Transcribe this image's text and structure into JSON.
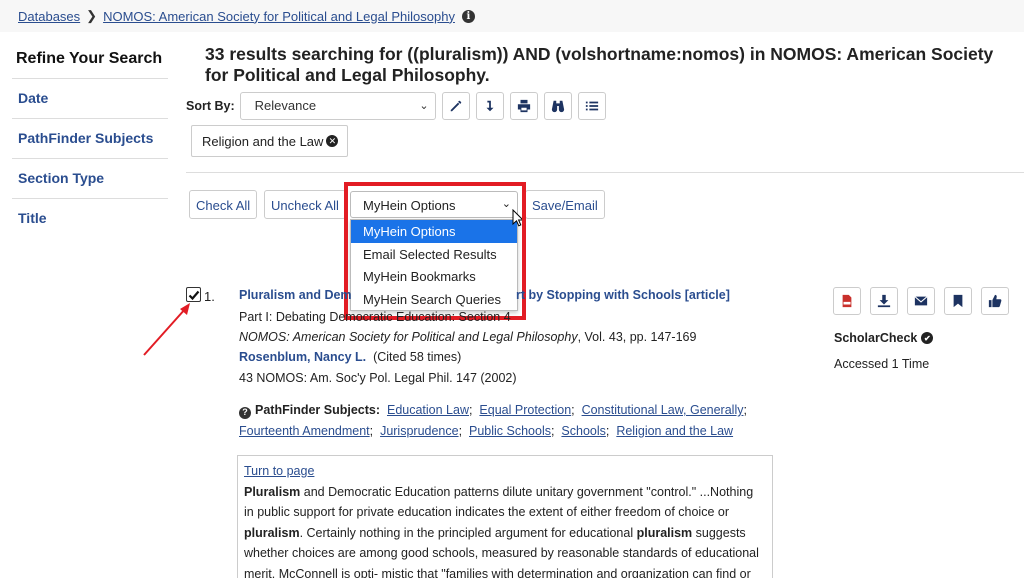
{
  "breadcrumb": {
    "root": "Databases",
    "current": "NOMOS: American Society for Political and Legal Philosophy"
  },
  "sidebar": {
    "title": "Refine Your Search",
    "items": [
      {
        "label": "Date"
      },
      {
        "label": "PathFinder Subjects"
      },
      {
        "label": "Section Type"
      },
      {
        "label": "Title"
      }
    ]
  },
  "results_heading": "33 results searching for ((pluralism)) AND (volshortname:nomos) in NOMOS: American Society for Political and Legal Philosophy.",
  "sort": {
    "label": "Sort By:",
    "value": "Relevance"
  },
  "facet_chip": "Religion and the Law",
  "bulk": {
    "check_all": "Check All",
    "uncheck_all": "Uncheck All",
    "myhein_value": "MyHein Options",
    "save_email": "Save/Email",
    "options": [
      "MyHein Options",
      "Email Selected Results",
      "MyHein Bookmarks",
      "MyHein Search Queries"
    ]
  },
  "result": {
    "number": "1.",
    "title_start": "Pluralism and Dem",
    "title_end": "rt by Stopping with Schools [article]",
    "part": "Part I: Debating Democratic Education: Section 4",
    "journal": "NOMOS: American Society for Political and Legal Philosophy",
    "vol": ", Vol. 43, pp. 147-169",
    "author": "Rosenblum, Nancy L.",
    "cited": "(Cited 58 times)",
    "citation": "43 NOMOS: Am. Soc'y Pol. Legal Phil. 147 (2002)",
    "pathfinder_label": "PathFinder Subjects:",
    "subjects": [
      "Education Law",
      "Equal Protection",
      "Constitutional Law, Generally",
      "Fourteenth Amendment",
      "Jurisprudence",
      "Public Schools",
      "Schools",
      "Religion and the Law"
    ],
    "turn_to_page": "Turn to page",
    "scholarcheck": "ScholarCheck",
    "accessed": "Accessed 1 Time"
  },
  "snippet": {
    "t1": "Pluralism",
    "t2": " and Democratic Education patterns dilute unitary government \"control.\" ...Nothing in public support for private education indicates the extent of either freedom of choice or ",
    "t3": "pluralism",
    "t4": ". Certainly nothing in the principled argument for educational ",
    "t5": "pluralism",
    "t6": " suggests whether choices are among good schools, measured by reasonable standards of educational merit. McConnell is opti- mistic that \"families with determination and organization can find or"
  },
  "colors": {
    "link": "#2a4d8f",
    "highlight_box": "#e21c24",
    "selected_option": "#1a73e8"
  }
}
